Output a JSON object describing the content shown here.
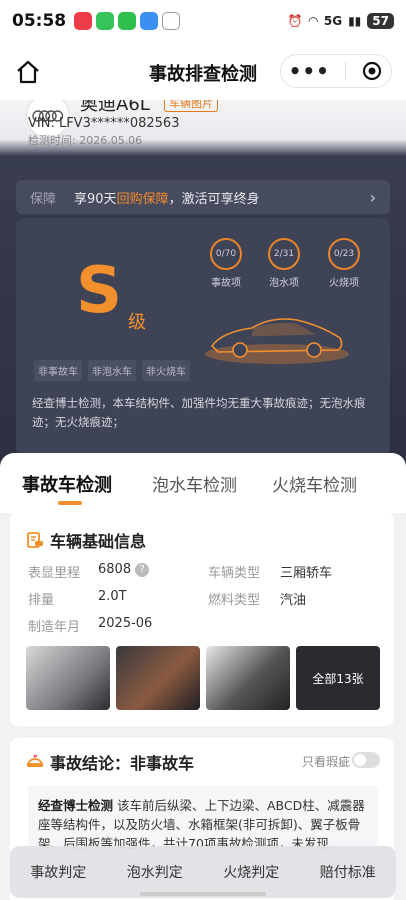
{
  "status": {
    "time": "05:58",
    "network": "5G",
    "battery": "57"
  },
  "nav": {
    "title": "事故排查检测"
  },
  "car": {
    "name": "奥迪A6L",
    "badge": "车辆图片",
    "vin": "VIN:  LFV3******082563",
    "check_time": "检测时间:    2026.05.06"
  },
  "guarantee": {
    "label": "保障",
    "pre": "享90天",
    "hl": "回购保障",
    "post": "，激活可享终身"
  },
  "grade": {
    "letter": "S",
    "level": "级",
    "stats": [
      {
        "value": "0/70",
        "label": "事故项"
      },
      {
        "value": "2/31",
        "label": "泡水项"
      },
      {
        "value": "0/23",
        "label": "火烧项"
      }
    ],
    "tags": [
      "非事故车",
      "非泡水车",
      "非火烧车"
    ],
    "conclusion": "经查博士检测，本车结构件、加强件均无重大事故痕迹；无泡水痕迹；无火烧痕迹；"
  },
  "tabs": [
    "事故车检测",
    "泡水车检测",
    "火烧车检测"
  ],
  "info": {
    "title": "车辆基础信息",
    "mileage_label": "表显里程",
    "mileage": "6808",
    "type_label": "车辆类型",
    "type": "三厢轿车",
    "disp_label": "排量",
    "disp": "2.0T",
    "fuel_label": "燃料类型",
    "fuel": "汽油",
    "date_label": "制造年月",
    "date": "2025-06",
    "more_photos": "全部13张"
  },
  "accident": {
    "title": "事故结论：非事故车",
    "toggle_label": "只看瑕疵",
    "text_bold": "经查博士检测",
    "text": "该车前后纵梁、上下边梁、ABCD柱、减震器座等结构件，以及防火墙、水箱框架(非可拆卸)、翼子板骨架、后围板等加强件，共计70项事故检测项，未发现"
  },
  "bottom": [
    "事故判定",
    "泡水判定",
    "火烧判定",
    "赔付标准"
  ],
  "colors": {
    "accent": "#f2902e",
    "hero_bg": "#2c2f40"
  }
}
